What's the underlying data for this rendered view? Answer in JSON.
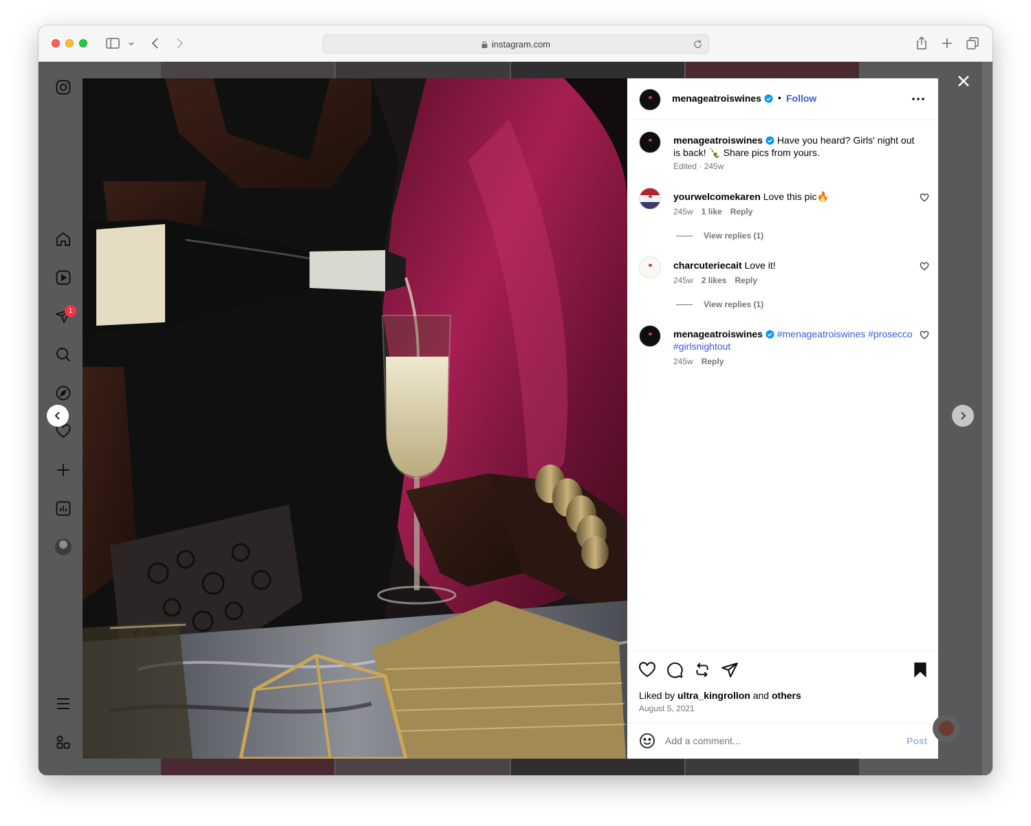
{
  "browser": {
    "url": "instagram.com"
  },
  "post": {
    "username": "menageatroiswines",
    "follow_label": "Follow",
    "separator": "•",
    "caption": {
      "username": "menageatroiswines",
      "text": "Have you heard? Girls' night out is back! 🍾 Share pics from yours.",
      "meta": "Edited · 245w"
    },
    "comments": [
      {
        "username": "yourwelcomekaren",
        "text": "Love this pic🔥",
        "time": "245w",
        "likes": "1 like",
        "reply": "Reply",
        "view_replies": "View replies (1)"
      },
      {
        "username": "charcuteriecait",
        "text": "Love it!",
        "time": "245w",
        "likes": "2 likes",
        "reply": "Reply",
        "view_replies": "View replies (1)"
      },
      {
        "username": "menageatroiswines",
        "text": "#menageatroiswines #prosecco #girlsnightout",
        "time": "245w",
        "reply": "Reply"
      }
    ],
    "liked_by_prefix": "Liked by",
    "liked_by_user": "ultra_kingrollon",
    "liked_by_and": "and",
    "liked_by_others": "others",
    "date": "August 5, 2021",
    "comment_placeholder": "Add a comment...",
    "post_label": "Post"
  },
  "sidenav": {
    "notification_count": "1"
  },
  "colors": {
    "link": "#3a5bd9",
    "verified": "#0095f6",
    "badge": "#ff3040"
  },
  "icons": [
    "instagram-icon",
    "home-icon",
    "reels-icon",
    "direct-icon",
    "search-icon",
    "explore-icon",
    "heart-icon",
    "create-icon",
    "dashboard-icon",
    "menu-icon",
    "more-apps-icon"
  ]
}
